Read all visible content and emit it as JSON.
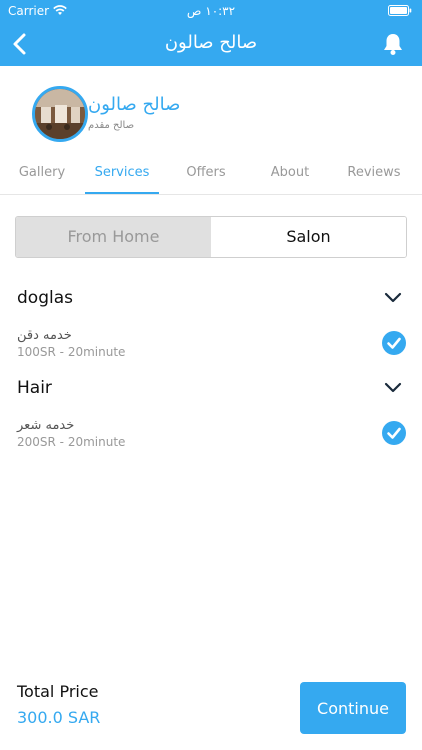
{
  "status_bar": {
    "carrier": "Carrier",
    "time": "١٠:٣٢ ص"
  },
  "nav": {
    "title": "صالح صالون",
    "back_icon": "chevron-left-icon",
    "bell_icon": "bell-icon"
  },
  "profile": {
    "name": "صالح صالون",
    "subtitle": "صالح مقدم"
  },
  "tabs": [
    {
      "label": "Gallery"
    },
    {
      "label": "Services",
      "active": true
    },
    {
      "label": "Offers"
    },
    {
      "label": "About"
    },
    {
      "label": "Reviews"
    }
  ],
  "location_segment": {
    "options": [
      "From Home",
      "Salon"
    ],
    "selected": "Salon"
  },
  "categories": [
    {
      "title": "doglas",
      "services": [
        {
          "name": "خدمه دقن",
          "detail": "100SR - 20minute",
          "checked": true
        }
      ]
    },
    {
      "title": "Hair",
      "services": [
        {
          "name": "خدمه شعر",
          "detail": "200SR - 20minute",
          "checked": true
        }
      ]
    }
  ],
  "footer": {
    "total_label": "Total Price",
    "total_value": "300.0 SAR",
    "continue_label": "Continue"
  },
  "colors": {
    "accent": "#35a9f0"
  }
}
